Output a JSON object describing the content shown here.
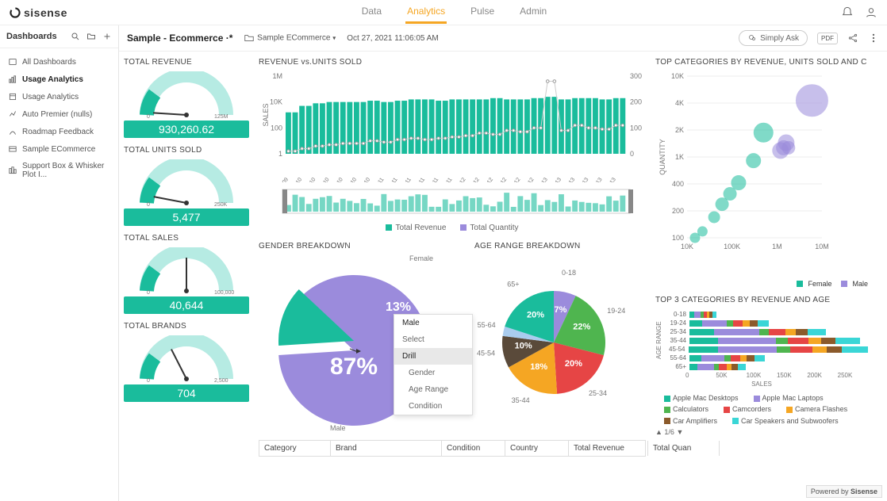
{
  "brand": "sisense",
  "topnav": {
    "data": "Data",
    "analytics": "Analytics",
    "pulse": "Pulse",
    "admin": "Admin"
  },
  "sidebar": {
    "title": "Dashboards",
    "items": [
      "All Dashboards",
      "Usage Analytics",
      "Usage Analytics",
      "Auto Premier (nulls)",
      "Roadmap Feedback",
      "Sample ECommerce",
      "Support Box & Whisker Plot I..."
    ],
    "active_idx": 1
  },
  "header": {
    "title": "Sample - Ecommerce ·*",
    "folder": "Sample ECommerce",
    "timestamp": "Oct 27, 2021 11:06:05 AM",
    "simply_ask": "Simply Ask",
    "pdf": "PDF"
  },
  "gauges": {
    "revenue": {
      "title": "TOTAL REVENUE",
      "value": "930,260.62",
      "min": "0",
      "max": "125M"
    },
    "units": {
      "title": "TOTAL UNITS SOLD",
      "value": "5,477",
      "min": "0",
      "max": "250K"
    },
    "sales": {
      "title": "TOTAL SALES",
      "value": "40,644",
      "min": "0",
      "max": "100,000"
    },
    "brands": {
      "title": "TOTAL BRANDS",
      "value": "704",
      "min": "0",
      "max": "2,500"
    }
  },
  "revenue_units": {
    "title": "REVENUE vs.UNITS SOLD",
    "ylabel": "SALES",
    "y1_ticks": [
      "1M",
      "10K",
      "100",
      "1"
    ],
    "y2_ticks": [
      "300",
      "200",
      "100",
      "0"
    ],
    "legend": {
      "a": "Total Revenue",
      "b": "Total Quantity"
    }
  },
  "gender": {
    "title": "GENDER BREAKDOWN",
    "female": {
      "label": "Female",
      "pct": "13%"
    },
    "male": {
      "label": "Male",
      "pct": "87%"
    }
  },
  "age": {
    "title": "AGE RANGE BREAKDOWN"
  },
  "ctx_menu": {
    "header": "Male",
    "select": "Select",
    "drill": "Drill",
    "gender": "Gender",
    "age": "Age Range",
    "cond": "Condition"
  },
  "scatter": {
    "title": "TOP CATEGORIES BY REVENUE, UNITS SOLD AND C",
    "ylabel": "QUANTITY",
    "y_ticks": [
      "10K",
      "4K",
      "2K",
      "1K",
      "400",
      "200",
      "100"
    ],
    "x_ticks": [
      "10K",
      "100K",
      "1M",
      "10M"
    ],
    "legend": {
      "female": "Female",
      "male": "Male"
    }
  },
  "stacked": {
    "title": "TOP 3 CATEGORIES BY REVENUE AND AGE",
    "ylabel": "AGE RANGE",
    "xlabel": "SALES",
    "rows": [
      "0-18",
      "19-24",
      "25-34",
      "35-44",
      "45-54",
      "55-64",
      "65+"
    ],
    "x_ticks": [
      "0",
      "50K",
      "100K",
      "150K",
      "200K",
      "250K"
    ],
    "legend": [
      "Apple Mac Desktops",
      "Apple Mac Laptops",
      "Calculators",
      "Camcorders",
      "Camera Flashes",
      "Car Amplifiers",
      "Car Speakers and Subwoofers"
    ],
    "colors": [
      "#1abc9c",
      "#9b8bdc",
      "#4fb54f",
      "#e64545",
      "#f5a623",
      "#8b5a2b",
      "#3ad6d6"
    ],
    "pager": "1/6"
  },
  "table": {
    "cols": [
      "Category",
      "Brand",
      "Condition",
      "Country",
      "Total Revenue",
      "Total Quan"
    ]
  },
  "powered": "Powered by",
  "chart_data": {
    "revenue_vs_units": {
      "type": "bar+line",
      "x": [
        "Nov 2009",
        "Jan 2010",
        "Mar 2010",
        "May 2010",
        "Jul 2010",
        "Sep 2010",
        "Nov 2010",
        "Jan 2011",
        "Mar 2011",
        "May 2011",
        "Jul 2011",
        "Sep 2011",
        "Nov 2011",
        "Jan 2012",
        "Mar 2012",
        "May 2012",
        "Jul 2012",
        "Sep 2012",
        "Nov 2012",
        "Jan 2013",
        "Mar 2013",
        "May 2013",
        "Jul 2013",
        "Sep 2013",
        "Nov 2013"
      ],
      "bar_series": {
        "name": "Total Revenue",
        "values_log": [
          3.2,
          3.7,
          3.9,
          4.0,
          4.0,
          4.0,
          4.1,
          4.0,
          4.1,
          4.2,
          4.2,
          4.1,
          4.2,
          4.2,
          4.2,
          4.3,
          4.2,
          4.2,
          4.3,
          4.4,
          4.2,
          4.3,
          4.3,
          4.2,
          4.3
        ]
      },
      "line_series": {
        "name": "Total Quantity",
        "values": [
          10,
          20,
          30,
          35,
          40,
          40,
          50,
          45,
          55,
          60,
          55,
          60,
          65,
          70,
          80,
          75,
          90,
          85,
          100,
          280,
          90,
          110,
          100,
          95,
          110
        ]
      },
      "y1": {
        "scale": "log",
        "range": [
          1,
          1000000
        ]
      },
      "y2": {
        "range": [
          0,
          300
        ]
      }
    },
    "gender_pie": {
      "type": "pie",
      "slices": [
        {
          "label": "Male",
          "value": 87,
          "color": "#9b8bdc"
        },
        {
          "label": "Female",
          "value": 13,
          "color": "#1abc9c"
        }
      ]
    },
    "age_pie": {
      "type": "pie",
      "slices": [
        {
          "label": "0-18",
          "value": 7,
          "color": "#9b8bdc"
        },
        {
          "label": "19-24",
          "color": "#4fb54f",
          "value": 22
        },
        {
          "label": "25-34",
          "color": "#e64545",
          "value": 20
        },
        {
          "label": "35-44",
          "color": "#f5a623",
          "value": 18
        },
        {
          "label": "45-54",
          "color": "#5a4a3a",
          "value": 10
        },
        {
          "label": "55-64",
          "color": "#aaccee",
          "value": 3
        },
        {
          "label": "65+",
          "color": "#1abc9c",
          "value": 20
        }
      ]
    },
    "scatter": {
      "type": "scatter",
      "xscale": "log",
      "yscale": "log",
      "xrange": [
        10000,
        10000000
      ],
      "yrange": [
        100,
        10000
      ],
      "points": [
        {
          "x": 15000,
          "y": 100,
          "r": 6,
          "g": "Female"
        },
        {
          "x": 22000,
          "y": 120,
          "r": 6,
          "g": "Female"
        },
        {
          "x": 40000,
          "y": 180,
          "r": 7,
          "g": "Female"
        },
        {
          "x": 60000,
          "y": 260,
          "r": 8,
          "g": "Female"
        },
        {
          "x": 90000,
          "y": 350,
          "r": 8,
          "g": "Female"
        },
        {
          "x": 140000,
          "y": 480,
          "r": 9,
          "g": "Female"
        },
        {
          "x": 300000,
          "y": 900,
          "r": 9,
          "g": "Female"
        },
        {
          "x": 500000,
          "y": 2000,
          "r": 12,
          "g": "Female"
        },
        {
          "x": 1200000,
          "y": 1200,
          "r": 10,
          "g": "Male"
        },
        {
          "x": 1400000,
          "y": 1300,
          "r": 9,
          "g": "Male"
        },
        {
          "x": 1600000,
          "y": 1500,
          "r": 10,
          "g": "Male"
        },
        {
          "x": 1800000,
          "y": 1300,
          "r": 8,
          "g": "Male"
        },
        {
          "x": 6000000,
          "y": 5000,
          "r": 20,
          "g": "Male"
        }
      ]
    },
    "stacked": {
      "type": "bar",
      "orientation": "horizontal",
      "rows": {
        "0-18": [
          6,
          8,
          3,
          4,
          3,
          4,
          5
        ],
        "19-24": [
          15,
          30,
          8,
          12,
          8,
          10,
          14
        ],
        "25-34": [
          30,
          55,
          12,
          20,
          12,
          15,
          22
        ],
        "35-44": [
          35,
          70,
          15,
          25,
          15,
          18,
          30
        ],
        "45-54": [
          38,
          75,
          18,
          28,
          18,
          20,
          33
        ],
        "55-64": [
          14,
          28,
          8,
          12,
          8,
          9,
          13
        ],
        "65+": [
          10,
          20,
          6,
          9,
          6,
          8,
          10
        ]
      },
      "unit": "K"
    }
  }
}
